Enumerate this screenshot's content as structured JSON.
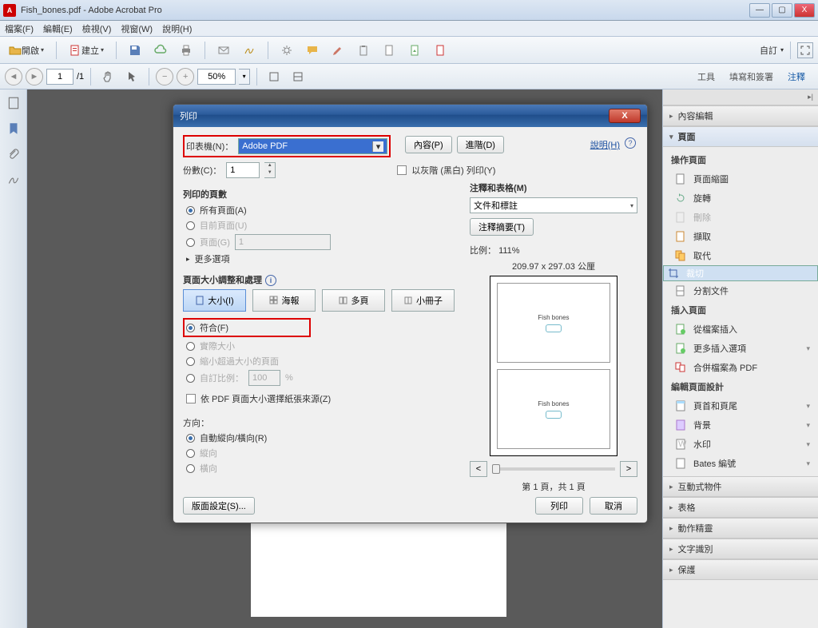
{
  "window": {
    "title": "Fish_bones.pdf - Adobe Acrobat Pro",
    "min": "—",
    "max": "▢",
    "close": "X"
  },
  "menu": [
    "檔案(F)",
    "編輯(E)",
    "檢視(V)",
    "視窗(W)",
    "說明(H)"
  ],
  "toolbar": {
    "open": "開啟",
    "create": "建立",
    "customize": "自訂"
  },
  "nav": {
    "page_current": "1",
    "page_total": "/1",
    "zoom": "50%"
  },
  "right_tabs": [
    "工具",
    "填寫和簽署",
    "注釋"
  ],
  "right_panel": {
    "sections": {
      "content_edit": "內容編輯",
      "page": "頁面",
      "interactive": "互動式物件",
      "table": "表格",
      "action": "動作精靈",
      "ocr": "文字識別",
      "protect": "保護"
    },
    "page_ops_hdr": "操作頁面",
    "page_ops": [
      "頁面縮圖",
      "旋轉",
      "刪除",
      "擷取",
      "取代",
      "裁切",
      "分割文件"
    ],
    "insert_hdr": "插入頁面",
    "insert_ops": [
      "從檔案插入",
      "更多插入選項",
      "合併檔案為 PDF"
    ],
    "design_hdr": "編輯頁面設計",
    "design_ops": [
      "頁首和頁尾",
      "背景",
      "水印",
      "Bates 編號"
    ]
  },
  "dialog": {
    "title": "列印",
    "printer_lbl": "印表機(N)：",
    "printer_val": "Adobe PDF",
    "props_btn": "內容(P)",
    "adv_btn": "進階(D)",
    "help": "說明(H)",
    "copies_lbl": "份數(C)：",
    "copies_val": "1",
    "grayscale": "以灰階 (黑白) 列印(Y)",
    "range_hdr": "列印的頁數",
    "range_all": "所有頁面(A)",
    "range_cur": "目前頁面(U)",
    "range_pages_lbl": "頁面(G)",
    "range_pages_val": "1",
    "more_opts": "更多選項",
    "size_hdr": "頁面大小調整和處理",
    "seg_size": "大小(I)",
    "seg_poster": "海報",
    "seg_multi": "多頁",
    "seg_booklet": "小冊子",
    "fit": "符合(F)",
    "actual": "實際大小",
    "shrink": "縮小超過大小的頁面",
    "custom_lbl": "自訂比例：",
    "custom_val": "100",
    "pct": "%",
    "source_chk": "依 PDF 頁面大小選擇紙張來源(Z)",
    "orient_hdr": "方向：",
    "orient_auto": "自動縱向/橫向(R)",
    "orient_port": "縱向",
    "orient_land": "橫向",
    "comments_hdr": "注釋和表格(M)",
    "comments_val": "文件和標註",
    "comments_btn": "注釋摘要(T)",
    "scale_lbl": "比例：",
    "scale_val": "111%",
    "paper_dim": "209.97 x 297.03 公厘",
    "preview_doc": "Fish bones",
    "preview_nav": "第 1 頁，共 1 頁",
    "page_setup": "版面設定(S)...",
    "ok": "列印",
    "cancel": "取消"
  }
}
